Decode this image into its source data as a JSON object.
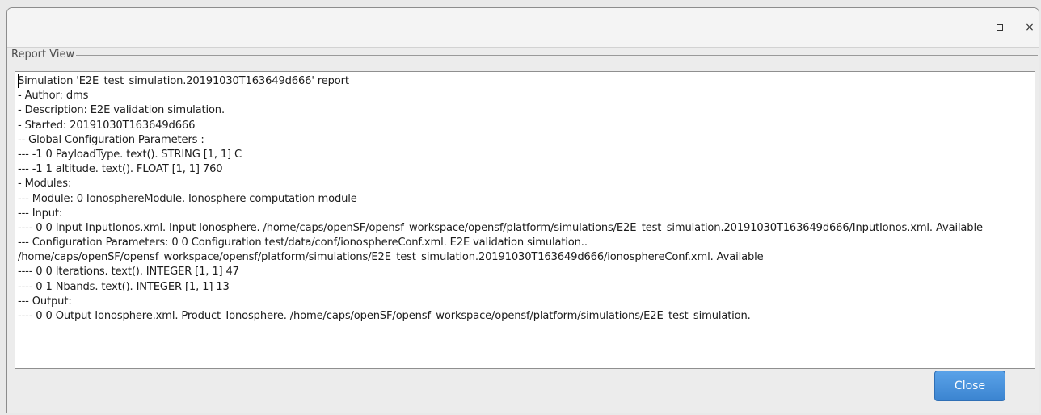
{
  "window": {
    "controls": {
      "maximize_icon": "maximize-icon",
      "close_icon": "close-icon",
      "close_glyph": "×"
    }
  },
  "report_view": {
    "title": "Report View",
    "lines": [
      "Simulation 'E2E_test_simulation.20191030T163649d666' report",
      "- Author: dms",
      "- Description: E2E validation simulation.",
      "- Started: 20191030T163649d666",
      "-- Global Configuration Parameters :",
      "--- -1 0 PayloadType. text(). STRING [1, 1] C",
      "--- -1 1 altitude. text(). FLOAT [1, 1] 760",
      "- Modules:",
      "--- Module: 0 IonosphereModule. Ionosphere computation module",
      "--- Input:",
      "---- 0 0 Input InputIonos.xml. Input Ionosphere. /home/caps/openSF/opensf_workspace/opensf/platform/simulations/E2E_test_simulation.20191030T163649d666/InputIonos.xml. Available",
      "--- Configuration Parameters: 0 0 Configuration test/data/conf/ionosphereConf.xml. E2E validation simulation.. /home/caps/openSF/opensf_workspace/opensf/platform/simulations/E2E_test_simulation.20191030T163649d666/ionosphereConf.xml. Available",
      "---- 0 0 Iterations. text(). INTEGER [1, 1] 47",
      "---- 0 1 Nbands. text(). INTEGER [1, 1] 13",
      "--- Output:",
      "---- 0 0 Output Ionosphere.xml. Product_Ionosphere. /home/caps/openSF/opensf_workspace/opensf/platform/simulations/E2E_test_simulation."
    ]
  },
  "footer": {
    "close_label": "Close",
    "close_color": "#3b84d0"
  }
}
